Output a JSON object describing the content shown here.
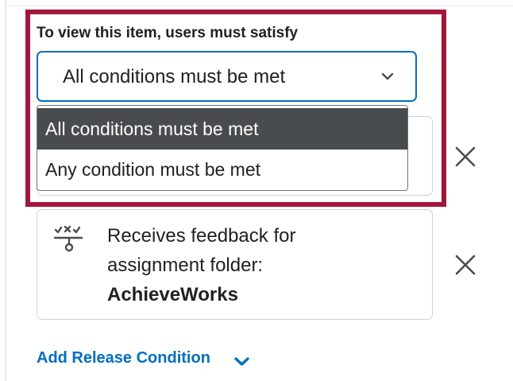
{
  "release_conditions": {
    "label": "To view this item, users must satisfy",
    "select": {
      "value": "All conditions must be met",
      "options": [
        "All conditions must be met",
        "Any condition must be met"
      ],
      "highlighted_option_index": 0
    },
    "conditions": [
      {
        "line1": "",
        "line2": "",
        "strong": "",
        "icon": "condition-icon"
      },
      {
        "line1": "Receives feedback for",
        "line2": "assignment folder:",
        "strong": "AchieveWorks",
        "icon": "assignment-feedback-icon"
      }
    ],
    "remove_icon": "close-icon",
    "add_link_label": "Add Release Condition",
    "add_link_icon": "chevron-down-icon"
  },
  "colors": {
    "highlight_border": "#a3163a",
    "link": "#006fbf",
    "selected_option_bg": "#494c4f",
    "focus_border": "#006fbf"
  }
}
